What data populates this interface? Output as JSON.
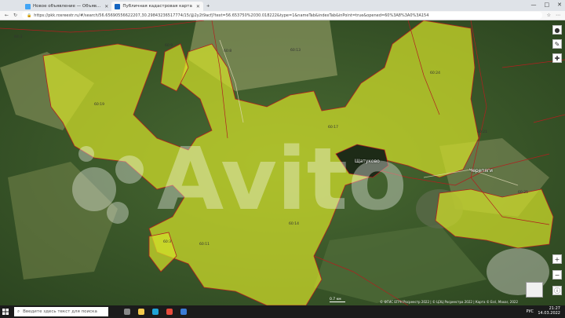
{
  "browser": {
    "tabs": [
      {
        "label": "Новое объявление — Объяв...",
        "icon": "avito-icon",
        "color": "#42a5f5"
      },
      {
        "label": "Публичная кадастровая карта",
        "icon": "rosreestr-icon",
        "color": "#1565c0"
      }
    ],
    "new_tab": "+",
    "url": "https://pkk.rosreestr.ru/#/search/56.65690556622207,30.29843236517774/15/@2y2t9acfj?text=56.653750%2030.018222&type=1&nameTab&indexTab&inPoint=true&opened=60%3A8%3A0%3A154",
    "window_controls": [
      "—",
      "□",
      "✕"
    ]
  },
  "map": {
    "place_labels": [
      {
        "text": "Щатуково"
      },
      {
        "text": "Черепяги"
      }
    ],
    "parcel_labels": [
      "60:3",
      "60:9",
      "60:8",
      "60:13",
      "60:24",
      "60:19",
      "60:17",
      "60:21",
      "60:25",
      "60:14",
      "60:11",
      "60:3"
    ],
    "scale": "0.7 км",
    "copyright": "© ФГИС ЕГРН Росреестр 2022 | © ЦЭЦ Росреестра 2022 | Карта © Esri, Maxar, 2022",
    "watermark": "Avito",
    "controls": [
      "●",
      "✎",
      "✚",
      "+",
      "−",
      "ⓘ"
    ]
  },
  "taskbar": {
    "search_placeholder": "Введите здесь текст для поиска",
    "time": "21:27",
    "date": "14.03.2022",
    "lang": "РУС"
  }
}
